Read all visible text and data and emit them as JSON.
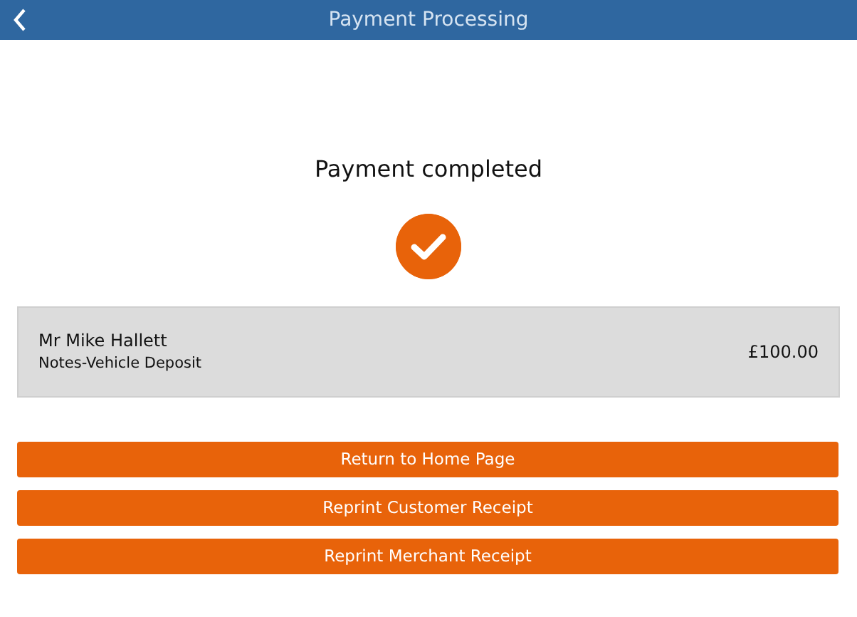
{
  "header": {
    "title": "Payment Processing"
  },
  "status": {
    "message": "Payment completed"
  },
  "payment": {
    "customer": "Mr Mike Hallett",
    "description": "Notes-Vehicle Deposit",
    "amount": "£100.00"
  },
  "buttons": [
    {
      "label": "Return to Home Page"
    },
    {
      "label": "Reprint Customer Receipt"
    },
    {
      "label": "Reprint Merchant Receipt"
    }
  ]
}
